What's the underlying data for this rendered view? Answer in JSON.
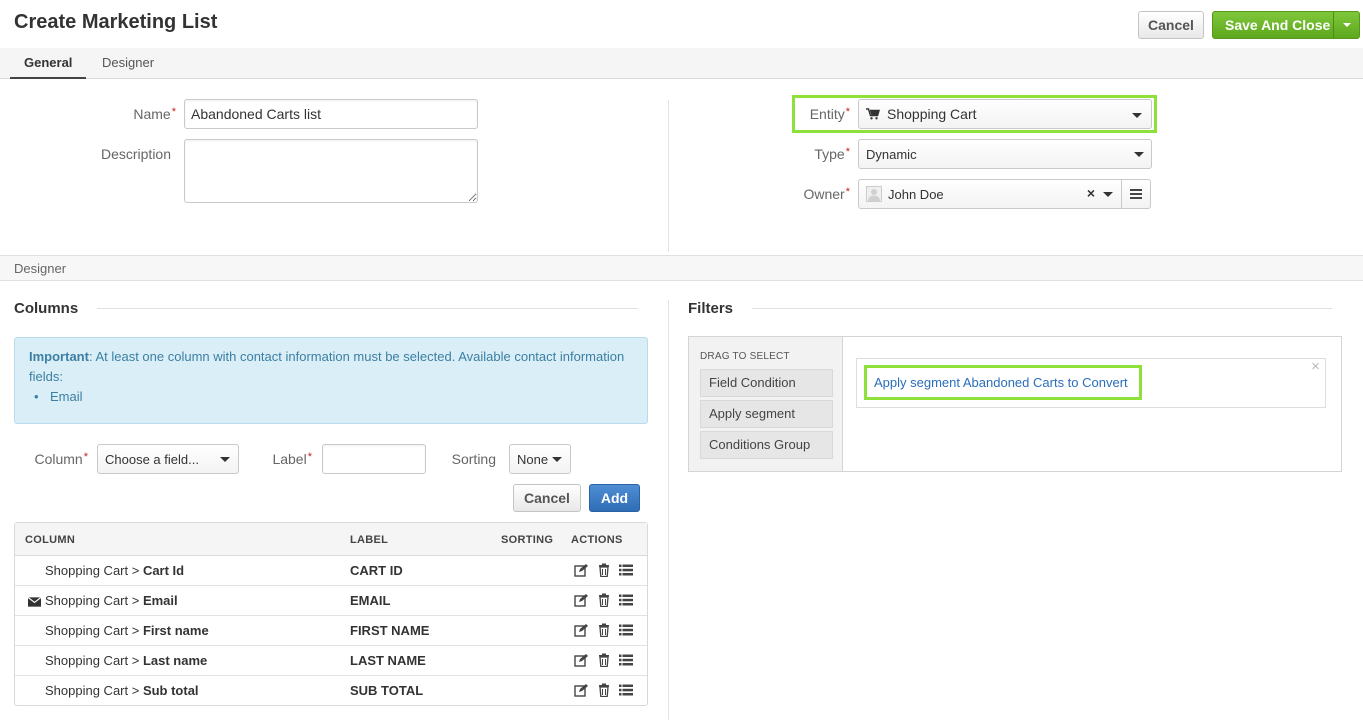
{
  "header": {
    "title": "Create Marketing List",
    "cancel_label": "Cancel",
    "save_label": "Save And Close"
  },
  "tabs": [
    {
      "label": "General",
      "active": true
    },
    {
      "label": "Designer",
      "active": false
    }
  ],
  "general": {
    "name_label": "Name",
    "name_value": "Abandoned Carts list",
    "description_label": "Description",
    "description_value": "",
    "entity_label": "Entity",
    "entity_value": "Shopping Cart",
    "entity_icon": "shopping-cart-icon",
    "type_label": "Type",
    "type_value": "Dynamic",
    "owner_label": "Owner",
    "owner_value": "John Doe"
  },
  "designer_section": {
    "title": "Designer",
    "columns_title": "Columns",
    "filters_title": "Filters",
    "alert": {
      "strong": "Important",
      "text": ": At least one column with contact information must be selected. Available contact information fields:",
      "fields": [
        "Email"
      ]
    },
    "column_form": {
      "column_label": "Column",
      "column_placeholder": "Choose a field...",
      "label_label": "Label",
      "label_value": "",
      "sorting_label": "Sorting",
      "sorting_value": "None",
      "cancel_label": "Cancel",
      "add_label": "Add"
    },
    "grid": {
      "headers": [
        "COLUMN",
        "LABEL",
        "SORTING",
        "ACTIONS"
      ],
      "rows": [
        {
          "prefix": "Shopping Cart > ",
          "field": "Cart Id",
          "label": "CART ID",
          "contact_icon": false
        },
        {
          "prefix": "Shopping Cart > ",
          "field": "Email",
          "label": "EMAIL",
          "contact_icon": true
        },
        {
          "prefix": "Shopping Cart > ",
          "field": "First name",
          "label": "FIRST NAME",
          "contact_icon": false
        },
        {
          "prefix": "Shopping Cart > ",
          "field": "Last name",
          "label": "LAST NAME",
          "contact_icon": false
        },
        {
          "prefix": "Shopping Cart > ",
          "field": "Sub total",
          "label": "SUB TOTAL",
          "contact_icon": false
        }
      ]
    },
    "filters": {
      "drag_label": "DRAG TO SELECT",
      "palette": [
        "Field Condition",
        "Apply segment",
        "Conditions Group"
      ],
      "condition_text": "Apply segment Abandoned Carts to Convert"
    }
  },
  "colors": {
    "highlight": "#8ee03a",
    "success": "#5ea81e",
    "primary": "#2f6db5",
    "link": "#2a6ebb"
  }
}
